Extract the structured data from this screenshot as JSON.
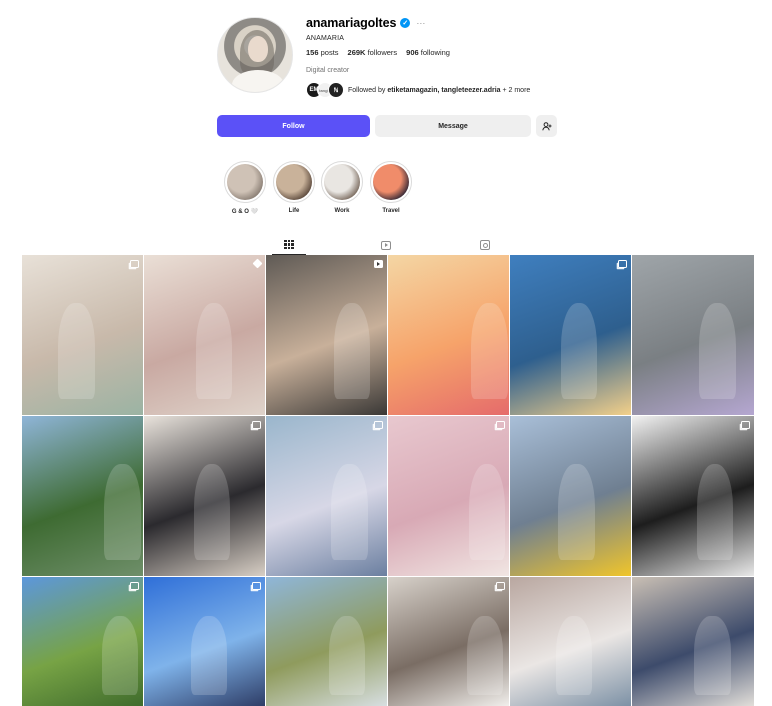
{
  "profile": {
    "username": "anamariagoltes",
    "full_name": "ANAMARIA",
    "category": "Digital creator",
    "stats": {
      "posts_count": "156",
      "posts_label": "posts",
      "followers_count": "269K",
      "followers_label": "followers",
      "following_count": "906",
      "following_label": "following"
    },
    "followed_by": {
      "prefix": "Followed by",
      "names": "etiketamagazin, tangleteezer.adria",
      "suffix": "+ 2 more",
      "avatar1": "EM",
      "avatar2": "tangle",
      "avatar3": "ℕ"
    }
  },
  "actions": {
    "follow": "Follow",
    "message": "Message",
    "suggest_icon": "person-plus-icon"
  },
  "highlights": [
    {
      "label": "G & O 🤍",
      "colors": [
        "#cfc2b6",
        "#8b7f75"
      ]
    },
    {
      "label": "Life",
      "colors": [
        "#c9b29a",
        "#5f4c3f"
      ]
    },
    {
      "label": "Work",
      "colors": [
        "#e9e6e2",
        "#7d6e62"
      ]
    },
    {
      "label": "Travel",
      "colors": [
        "#f08c6a",
        "#3b2b37"
      ]
    }
  ],
  "tabs": [
    {
      "name": "posts",
      "icon": "grid-icon"
    },
    {
      "name": "reels",
      "icon": "reels-icon"
    },
    {
      "name": "tagged",
      "icon": "tagged-icon"
    }
  ],
  "posts": [
    {
      "desc": "newborn-blanket",
      "badge": "multi",
      "colors": [
        "#e8e1d8",
        "#c8b9aa",
        "#9bb3a3"
      ]
    },
    {
      "desc": "hands-baby",
      "badge": "pin",
      "colors": [
        "#eadfd6",
        "#c9a9a2",
        "#dfd3ca"
      ]
    },
    {
      "desc": "car-selfie",
      "badge": "video",
      "colors": [
        "#5f5a55",
        "#c8b09a",
        "#3a3836"
      ]
    },
    {
      "desc": "sunset-dress",
      "badge": "none",
      "colors": [
        "#f4d6a4",
        "#f6a36a",
        "#e56b6b"
      ]
    },
    {
      "desc": "boat-sea",
      "badge": "multi",
      "colors": [
        "#3f7fbf",
        "#2e5f8e",
        "#f3d08a"
      ]
    },
    {
      "desc": "toddler-gravel",
      "badge": "none",
      "colors": [
        "#9fa5a9",
        "#7a7f83",
        "#b5a7d1"
      ]
    },
    {
      "desc": "pond-trees",
      "badge": "none",
      "colors": [
        "#8fb5d8",
        "#3e6b32",
        "#6f8f6a"
      ]
    },
    {
      "desc": "mirror-black",
      "badge": "multi",
      "colors": [
        "#e9e3dc",
        "#2b2a2e",
        "#d8cfc5"
      ]
    },
    {
      "desc": "pool-mom",
      "badge": "multi",
      "colors": [
        "#9ab6cc",
        "#d7d7e6",
        "#6b7fa0"
      ]
    },
    {
      "desc": "balloons",
      "badge": "multi",
      "colors": [
        "#e8c8cf",
        "#d8a9b5",
        "#f1e6e3"
      ]
    },
    {
      "desc": "city-stroller",
      "badge": "none",
      "colors": [
        "#a9bfd8",
        "#6f7f91",
        "#f0c52b"
      ]
    },
    {
      "desc": "pregnant-studio",
      "badge": "multi",
      "colors": [
        "#f2f2f2",
        "#1d1d1d",
        "#e9e9e9"
      ]
    },
    {
      "desc": "meadow-dog",
      "badge": "multi",
      "colors": [
        "#5c97dc",
        "#77a345",
        "#3e6a2c"
      ]
    },
    {
      "desc": "tennis",
      "badge": "multi",
      "colors": [
        "#2f6fd8",
        "#7fb3ea",
        "#2c3a63"
      ]
    },
    {
      "desc": "valley-dog",
      "badge": "none",
      "colors": [
        "#8fb6d9",
        "#8f9b5d",
        "#d9e0e4"
      ]
    },
    {
      "desc": "dog-kitchen",
      "badge": "multi",
      "colors": [
        "#d7d1ca",
        "#7a6d64",
        "#f4f2ef"
      ]
    },
    {
      "desc": "puppy-selfie",
      "badge": "none",
      "colors": [
        "#b9a7a0",
        "#eae6e4",
        "#7a8fa4"
      ]
    },
    {
      "desc": "mirror-jeans",
      "badge": "none",
      "colors": [
        "#c9bfb4",
        "#3d4b6b",
        "#e6e2dc"
      ]
    }
  ]
}
